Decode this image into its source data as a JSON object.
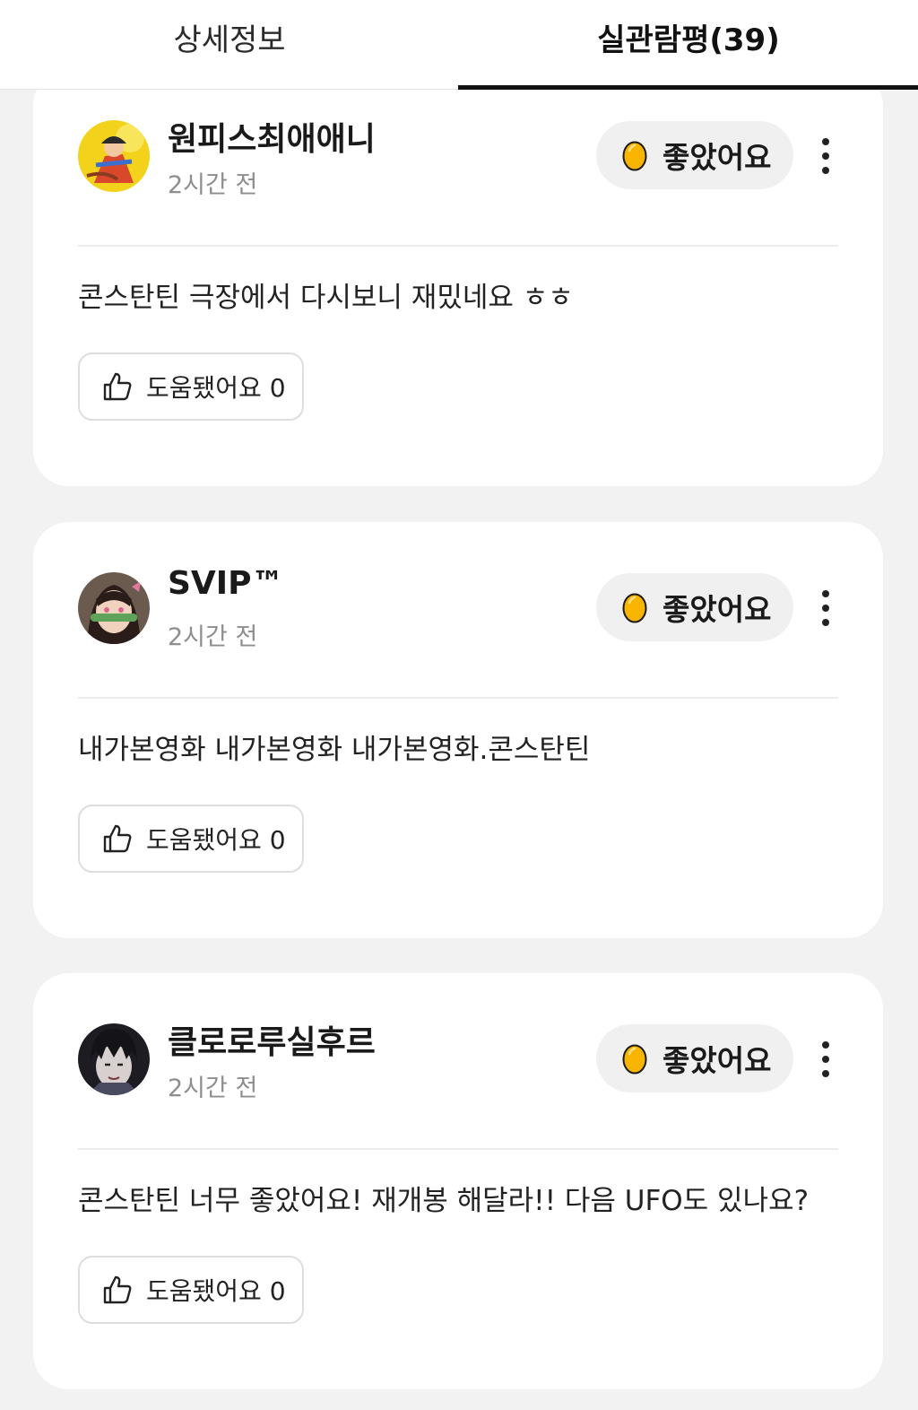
{
  "tabs": [
    {
      "label": "상세정보",
      "active": false
    },
    {
      "label": "실관람평(39)",
      "active": true
    }
  ],
  "reviews": [
    {
      "nickname": "원피스최애애니",
      "time": "2시간 전",
      "rating_label": "좋았어요",
      "comment": "콘스탄틴 극장에서 다시보니 재밌네요 ㅎㅎ",
      "helpful_label": "도움됐어요",
      "helpful_count": "0",
      "avatar": "one-piece-character-avatar"
    },
    {
      "nickname": "SVIP™",
      "time": "2시간 전",
      "rating_label": "좋았어요",
      "comment": "내가본영화 내가본영화 내가본영화.콘스탄틴",
      "helpful_label": "도움됐어요",
      "helpful_count": "0",
      "avatar": "anime-girl-avatar"
    },
    {
      "nickname": "클로로루실후르",
      "time": "2시간 전",
      "rating_label": "좋았어요",
      "comment": "콘스탄틴 너무 좋았어요! 재개봉 해달라!! 다음 UFO도 있나요?",
      "helpful_label": "도움됐어요",
      "helpful_count": "0",
      "avatar": "anime-boy-avatar"
    }
  ],
  "colors": {
    "egg": "#f7b500",
    "background": "#f2f2f2",
    "card": "#ffffff",
    "active_tab_underline": "#111111"
  },
  "icons": [
    "egg-icon",
    "more-vertical-icon",
    "thumbs-up-icon"
  ]
}
